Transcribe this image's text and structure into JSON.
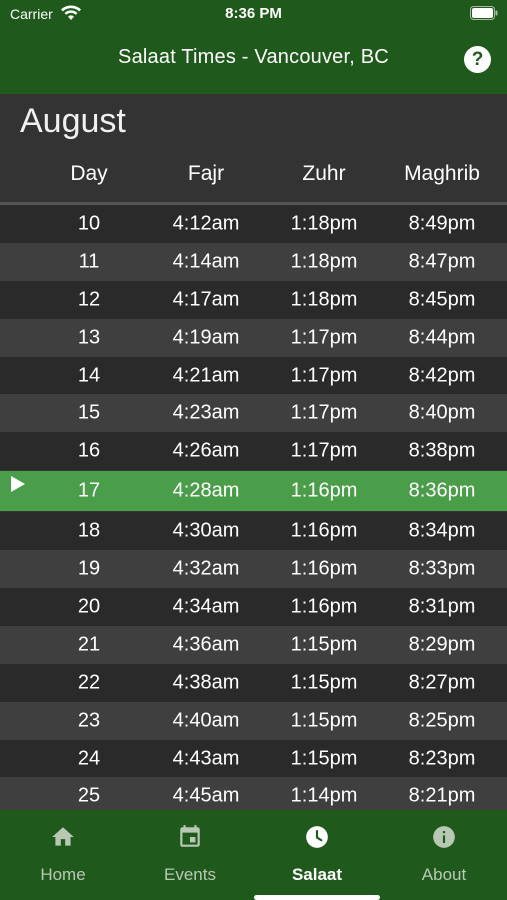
{
  "status_bar": {
    "carrier": "Carrier",
    "time": "8:36 PM"
  },
  "header": {
    "title": "Salaat Times - Vancouver, BC",
    "help_label": "?"
  },
  "month": "August",
  "columns": {
    "day": "Day",
    "fajr": "Fajr",
    "zuhr": "Zuhr",
    "maghrib": "Maghrib"
  },
  "rows": [
    {
      "day": "10",
      "fajr": "4:12am",
      "zuhr": "1:18pm",
      "maghrib": "8:49pm"
    },
    {
      "day": "11",
      "fajr": "4:14am",
      "zuhr": "1:18pm",
      "maghrib": "8:47pm"
    },
    {
      "day": "12",
      "fajr": "4:17am",
      "zuhr": "1:18pm",
      "maghrib": "8:45pm"
    },
    {
      "day": "13",
      "fajr": "4:19am",
      "zuhr": "1:17pm",
      "maghrib": "8:44pm"
    },
    {
      "day": "14",
      "fajr": "4:21am",
      "zuhr": "1:17pm",
      "maghrib": "8:42pm"
    },
    {
      "day": "15",
      "fajr": "4:23am",
      "zuhr": "1:17pm",
      "maghrib": "8:40pm"
    },
    {
      "day": "16",
      "fajr": "4:26am",
      "zuhr": "1:17pm",
      "maghrib": "8:38pm"
    },
    {
      "day": "17",
      "fajr": "4:28am",
      "zuhr": "1:16pm",
      "maghrib": "8:36pm",
      "current": true
    },
    {
      "day": "18",
      "fajr": "4:30am",
      "zuhr": "1:16pm",
      "maghrib": "8:34pm"
    },
    {
      "day": "19",
      "fajr": "4:32am",
      "zuhr": "1:16pm",
      "maghrib": "8:33pm"
    },
    {
      "day": "20",
      "fajr": "4:34am",
      "zuhr": "1:16pm",
      "maghrib": "8:31pm"
    },
    {
      "day": "21",
      "fajr": "4:36am",
      "zuhr": "1:15pm",
      "maghrib": "8:29pm"
    },
    {
      "day": "22",
      "fajr": "4:38am",
      "zuhr": "1:15pm",
      "maghrib": "8:27pm"
    },
    {
      "day": "23",
      "fajr": "4:40am",
      "zuhr": "1:15pm",
      "maghrib": "8:25pm"
    },
    {
      "day": "24",
      "fajr": "4:43am",
      "zuhr": "1:15pm",
      "maghrib": "8:23pm"
    },
    {
      "day": "25",
      "fajr": "4:45am",
      "zuhr": "1:14pm",
      "maghrib": "8:21pm"
    }
  ],
  "tabs": [
    {
      "label": "Home",
      "icon": "home-icon"
    },
    {
      "label": "Events",
      "icon": "calendar-icon"
    },
    {
      "label": "Salaat",
      "icon": "clock-icon",
      "active": true
    },
    {
      "label": "About",
      "icon": "info-icon"
    }
  ],
  "colors": {
    "brand_green": "#1f5a1c",
    "highlight_green": "#4a9e4a",
    "background": "#333333"
  }
}
